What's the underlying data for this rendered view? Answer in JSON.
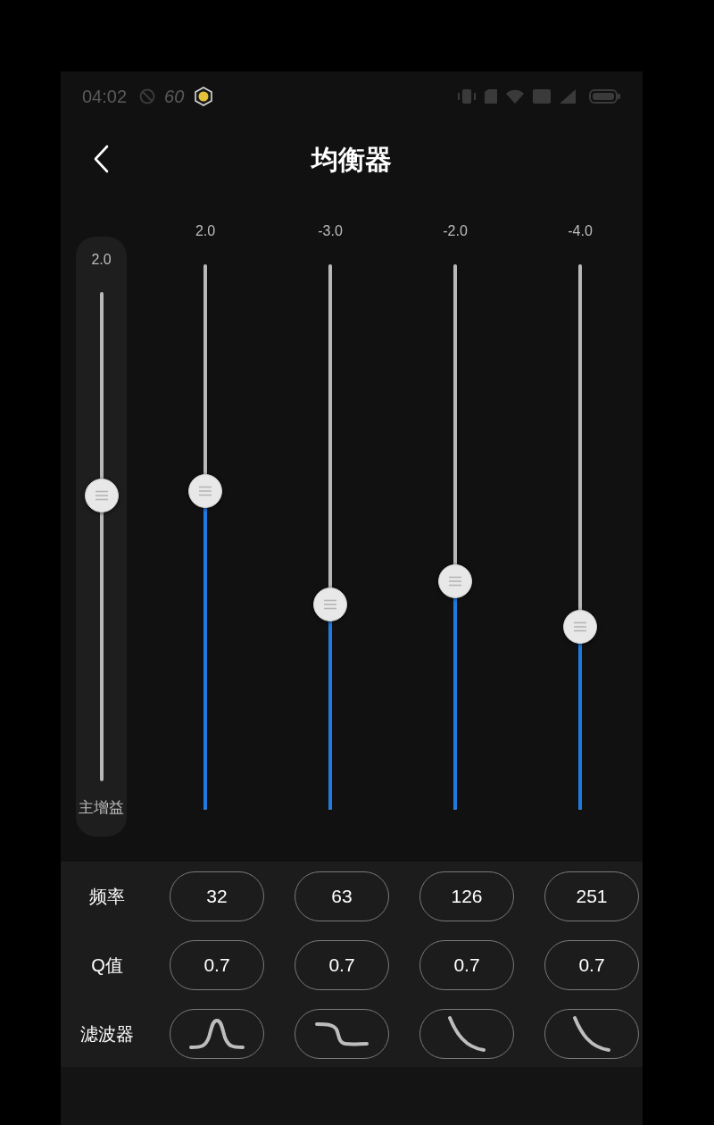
{
  "status_bar": {
    "time": "04:02",
    "speed": "60"
  },
  "header": {
    "title": "均衡器"
  },
  "master_gain": {
    "value": "2.0",
    "label": "主增益",
    "level": 0.584
  },
  "bands": [
    {
      "value": "2.0",
      "level": 0.584
    },
    {
      "value": "-3.0",
      "level": 0.376
    },
    {
      "value": "-2.0",
      "level": 0.419
    },
    {
      "value": "-4.0",
      "level": 0.336
    }
  ],
  "parameters": [
    {
      "label": "频率",
      "kind": "text",
      "values": [
        "32",
        "63",
        "126",
        "251"
      ]
    },
    {
      "label": "Q值",
      "kind": "text",
      "values": [
        "0.7",
        "0.7",
        "0.7",
        "0.7"
      ]
    },
    {
      "label": "滤波器",
      "kind": "filter",
      "filters": [
        {
          "kind": "peak"
        },
        {
          "kind": "shelf"
        },
        {
          "kind": "curve"
        },
        {
          "kind": "curve"
        }
      ]
    }
  ]
}
